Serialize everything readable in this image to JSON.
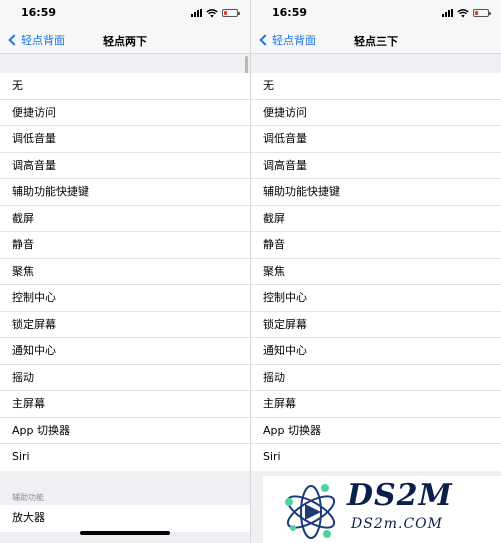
{
  "left": {
    "status": {
      "time": "16:59"
    },
    "nav": {
      "back_label": "轻点背面",
      "title": "轻点两下"
    },
    "items": [
      "无",
      "便捷访问",
      "调低音量",
      "调高音量",
      "辅助功能快捷键",
      "截屏",
      "静音",
      "聚焦",
      "控制中心",
      "锁定屏幕",
      "通知中心",
      "摇动",
      "主屏幕",
      "App 切换器",
      "Siri"
    ],
    "section2": {
      "header": "辅助功能",
      "items": [
        "放大器"
      ]
    }
  },
  "right": {
    "status": {
      "time": "16:59"
    },
    "nav": {
      "back_label": "轻点背面",
      "title": "轻点三下"
    },
    "items": [
      "无",
      "便捷访问",
      "调低音量",
      "调高音量",
      "辅助功能快捷键",
      "截屏",
      "静音",
      "聚焦",
      "控制中心",
      "锁定屏幕",
      "通知中心",
      "摇动",
      "主屏幕",
      "App 切换器",
      "Siri"
    ]
  },
  "watermark": {
    "logo": "DS2M",
    "sub": "DS2m.COM"
  },
  "colors": {
    "accent": "#1a73e8",
    "battery_low": "#e53935",
    "background": "#efeff4"
  },
  "icons": [
    "chevron-left-icon",
    "signal-icon",
    "wifi-icon",
    "battery-icon",
    "atom-logo-icon"
  ]
}
